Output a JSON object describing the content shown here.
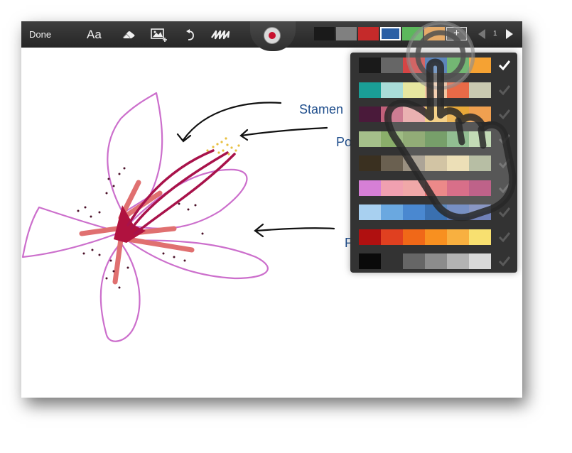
{
  "toolbar": {
    "done_label": "Done",
    "font_label": "Aa",
    "page_number": "1",
    "swatches": [
      "#1a1a1a",
      "#808080",
      "#c52a2a",
      "#2a5fa5",
      "#5cb85c",
      "#f0a24a"
    ],
    "add_color_label": "+"
  },
  "annotations": {
    "stamen": "Stamen",
    "pollen": "Po",
    "petal": "P"
  },
  "palette": {
    "rows": [
      [
        "#1a1a1a",
        "#666666",
        "#d64545",
        "#3a6fb5",
        "#57b257",
        "#f5a233"
      ],
      [
        "#1a9e96",
        "#a9dcd8",
        "#e6e6a0",
        "#f2c6a0",
        "#e86a47",
        "#c9c9b0"
      ],
      [
        "#4a1a3a",
        "#c2607a",
        "#e6a0a0",
        "#f3c870",
        "#e8a838",
        "#f0a050"
      ],
      [
        "#a5bf8a",
        "#8aae6a",
        "#7a9a5a",
        "#5a8a4a",
        "#7ab07a",
        "#b6d3a6"
      ],
      [
        "#3a3020",
        "#6a6050",
        "#9a9080",
        "#c8b890",
        "#e8d8a8",
        "#a8b090"
      ],
      [
        "#d67fd6",
        "#f0a0b0",
        "#f0a8a8",
        "#e87070",
        "#d05070",
        "#b04070"
      ],
      [
        "#a8d0f0",
        "#6aa8e0",
        "#4a88d0",
        "#3a70b0",
        "#5a78b8",
        "#7080b8"
      ],
      [
        "#b01010",
        "#e04020",
        "#f06818",
        "#f89020",
        "#f8b040",
        "#f8e070"
      ],
      [
        "#0a0a0a",
        "#333333",
        "#666666",
        "#8c8c8c",
        "#b3b3b3",
        "#d9d9d9"
      ]
    ],
    "selected_row": 0
  }
}
